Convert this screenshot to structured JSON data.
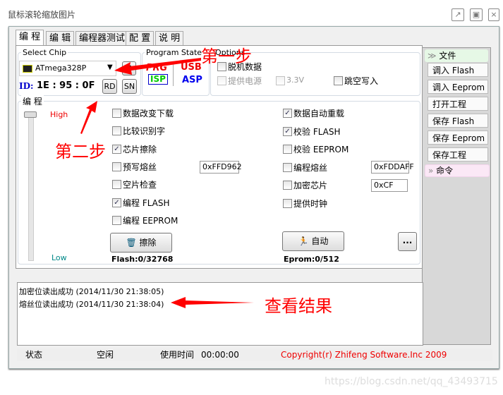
{
  "window": {
    "title": "鼠标滚轮缩放图片"
  },
  "tabs": [
    "编 程",
    "编 辑",
    "编程器测试",
    "配 置",
    "说 明"
  ],
  "chip": {
    "group_label": "Select Chip",
    "selected": "ATmega328P",
    "id_label": "ID:",
    "id_value": "1E : 95 : 0F",
    "rd": "RD",
    "sn": "SN"
  },
  "program_state": {
    "label": "Program State",
    "prg": "PRG",
    "isp": "ISP",
    "usb": "USB",
    "asp": "ASP"
  },
  "options": {
    "label": "Options",
    "items": [
      {
        "label": "脱机数据",
        "checked": false
      },
      {
        "label": "提供电源",
        "checked": false,
        "disabled": true
      },
      {
        "label": "3.3V",
        "checked": false,
        "disabled": true
      },
      {
        "label": "跳空写入",
        "checked": false
      }
    ]
  },
  "program": {
    "label": "编 程",
    "high": "High",
    "low": "Low",
    "left": [
      {
        "label": "数据改变下载",
        "checked": false
      },
      {
        "label": "比较识别字",
        "checked": false
      },
      {
        "label": "芯片擦除",
        "checked": true
      },
      {
        "label": "预写熔丝",
        "checked": false
      },
      {
        "label": "空片检查",
        "checked": false
      },
      {
        "label": "编程 FLASH",
        "checked": true
      },
      {
        "label": "编程 EEPROM",
        "checked": false
      }
    ],
    "right": [
      {
        "label": "数据自动重载",
        "checked": true
      },
      {
        "label": "校验 FLASH",
        "checked": true
      },
      {
        "label": "校验 EEPROM",
        "checked": false
      },
      {
        "label": "编程熔丝",
        "checked": false
      },
      {
        "label": "加密芯片",
        "checked": false
      },
      {
        "label": "提供时钟",
        "checked": false
      }
    ],
    "prefuse_value": "0xFFD962",
    "fuse_value": "0xFDDAFF",
    "lock_value": "0xCF",
    "erase_btn": "擦除",
    "auto_btn": "自动",
    "more_btn": "...",
    "flash_count": "Flash:0/32768",
    "eprom_count": "Eprom:0/512"
  },
  "sidebar": {
    "file_header": "文件",
    "buttons": [
      "调入 Flash",
      "调入 Eeprom",
      "打开工程",
      "保存 Flash",
      "保存 Eeprom",
      "保存工程"
    ],
    "cmd_header": "命令"
  },
  "log": [
    "加密位读出成功 (2014/11/30 21:38:05)",
    "熔丝位读出成功 (2014/11/30 21:38:04)"
  ],
  "status": {
    "label": "状态",
    "state": "空闲",
    "time_label": "使用时间",
    "time": "00:00:00",
    "copyright": "Copyright(r) Zhifeng Software.Inc 2009"
  },
  "annotations": {
    "step1": "第一步",
    "step2": "第二步",
    "result": "查看结果"
  },
  "watermark": "https://blog.csdn.net/qq_43493715"
}
